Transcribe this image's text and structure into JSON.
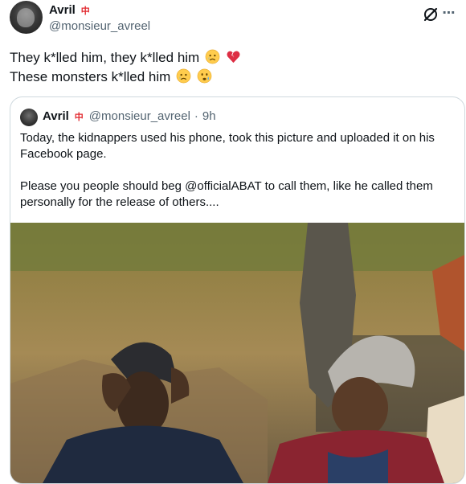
{
  "author": {
    "name": "Avril",
    "flag_char": "中",
    "handle": "@monsieur_avreel"
  },
  "tweet": {
    "line1": "They k*lled him, they k*lled him",
    "line2": "These monsters k*lled him",
    "line1_emojis": [
      "crying-face-emoji",
      "broken-heart-emoji"
    ],
    "line2_emojis": [
      "crying-face-emoji",
      "worried-face-emoji"
    ]
  },
  "quote": {
    "name": "Avril",
    "flag_char": "中",
    "handle": "@monsieur_avreel",
    "separator": "·",
    "time": "9h",
    "paragraph1": "Today, the kidnappers used his phone, took this picture and uploaded it on his Facebook page.",
    "paragraph2": "Please you people should beg @officialABAT to call them, like he called them personally for the release of others...."
  },
  "colors": {
    "text": "#0f1419",
    "secondary": "#536471",
    "border": "#cfd9de",
    "flag_red": "#e2292f"
  },
  "icons": {
    "more": "more-icon",
    "grok": "grok-icon"
  }
}
